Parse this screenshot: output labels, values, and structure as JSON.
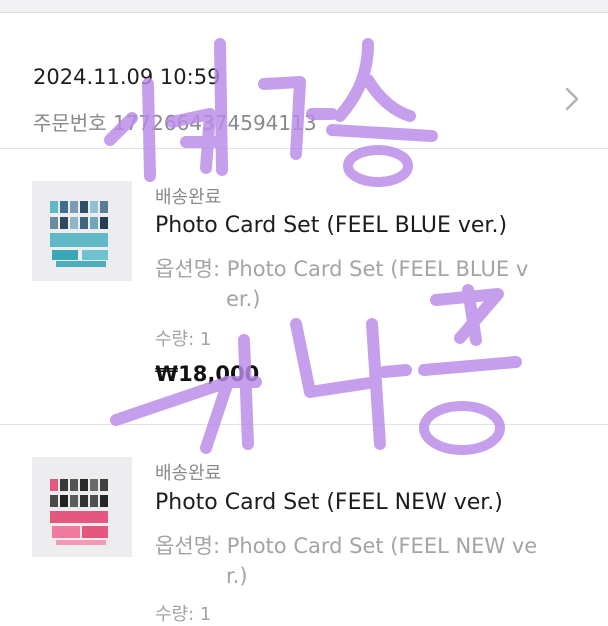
{
  "order": {
    "datetime": "2024.11.09 10:59",
    "number_label": "주문번호",
    "number": "1772664374594113"
  },
  "items": [
    {
      "status": "배송완료",
      "title": "Photo Card Set (FEEL BLUE ver.)",
      "option_label": "옵션명:",
      "option_line1": "Photo Card Set (FEEL BLUE v",
      "option_line2": "er.)",
      "qty_label": "수량:",
      "qty": "1",
      "price": "₩18,000",
      "accent": "#5fb9c6"
    },
    {
      "status": "배송완료",
      "title": "Photo Card Set (FEEL NEW ver.)",
      "option_label": "옵션명:",
      "option_line1": "Photo Card Set (FEEL NEW ve",
      "option_line2": "r.)",
      "qty_label": "수량:",
      "qty": "1",
      "accent": "#e4577e"
    }
  ],
  "overlay": {
    "handwriting_color": "#b98ae8"
  }
}
